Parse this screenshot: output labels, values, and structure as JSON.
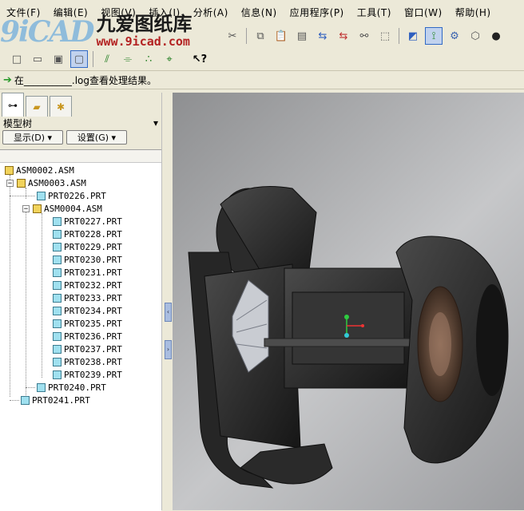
{
  "menu": [
    "文件(F)",
    "编辑(E)",
    "视图(V)",
    "插入(I)",
    "分析(A)",
    "信息(N)",
    "应用程序(P)",
    "工具(T)",
    "窗口(W)",
    "帮助(H)"
  ],
  "watermark": {
    "logo": "9iCAD",
    "site_name": "九爱图纸库",
    "url": "www.9icad.com"
  },
  "status_message": "在__________.log查看处理结果。",
  "panel": {
    "title": "模型树",
    "show_button": "显示(D)",
    "settings_button": "设置(G)"
  },
  "tree": {
    "root": "ASM0002.ASM",
    "asm3": "ASM0003.ASM",
    "prt226": "PRT0226.PRT",
    "asm4": "ASM0004.ASM",
    "parts": [
      "PRT0227.PRT",
      "PRT0228.PRT",
      "PRT0229.PRT",
      "PRT0230.PRT",
      "PRT0231.PRT",
      "PRT0232.PRT",
      "PRT0233.PRT",
      "PRT0234.PRT",
      "PRT0235.PRT",
      "PRT0236.PRT",
      "PRT0237.PRT",
      "PRT0238.PRT",
      "PRT0239.PRT"
    ],
    "prt240": "PRT0240.PRT",
    "prt241": "PRT0241.PRT"
  },
  "icons": {
    "tb1": [
      "cut-icon",
      "copy-icon",
      "paste-icon",
      "paste-special-icon",
      "regenerate-icon",
      "regenerate-manager-icon",
      "find-icon",
      "select-box-icon",
      "named-view-icon",
      "spin-center-icon",
      "model-display-icon",
      "datum-display-icon",
      "shading-icon"
    ],
    "tb2": [
      "new-icon",
      "open-icon",
      "save-icon",
      "print-icon",
      "datum-plane-icon",
      "datum-axis-icon",
      "datum-point-icon",
      "coordinate-system-icon",
      "context-help-icon"
    ]
  }
}
